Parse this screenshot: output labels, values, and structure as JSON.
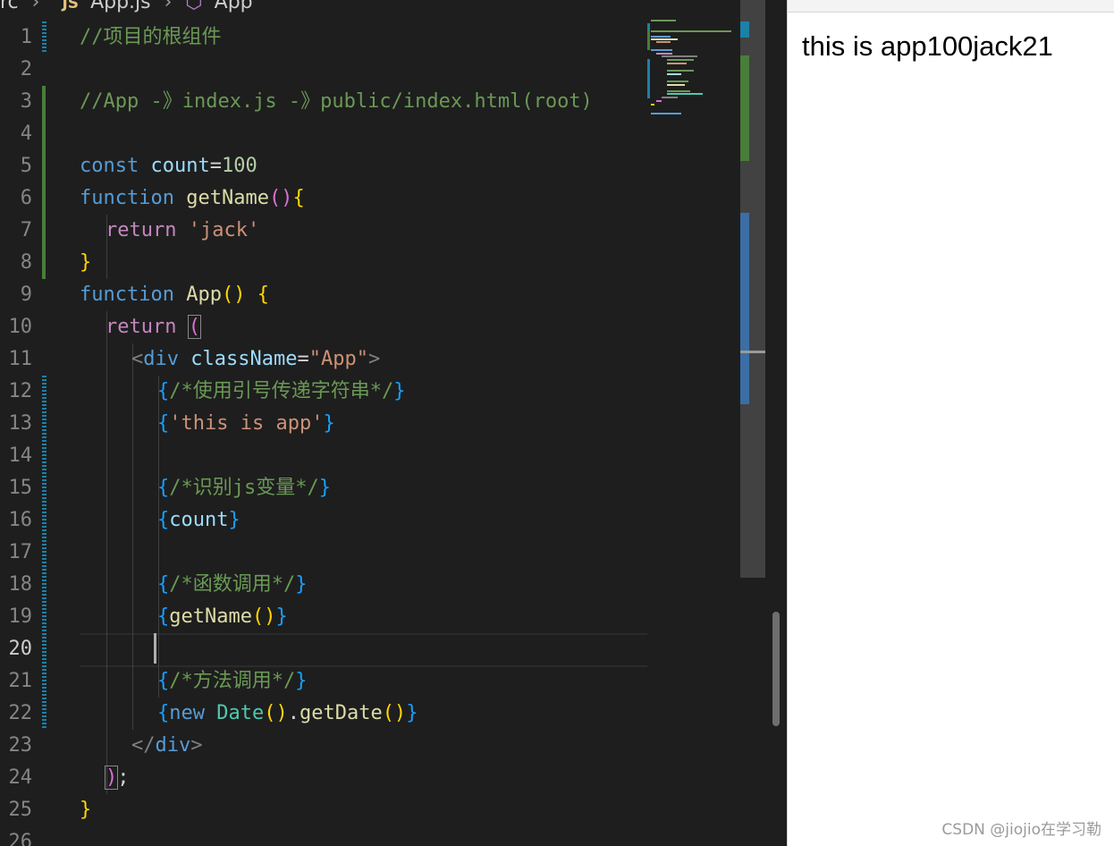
{
  "breadcrumb": {
    "folder": "rc",
    "file_badge": "JS",
    "file": "App.js",
    "symbol": "App",
    "icons": [
      "chevron-right-icon",
      "symbol-class-icon"
    ]
  },
  "editor": {
    "active_line": "20",
    "line_numbers": [
      "1",
      "2",
      "3",
      "4",
      "5",
      "6",
      "7",
      "8",
      "9",
      "10",
      "11",
      "12",
      "13",
      "14",
      "15",
      "16",
      "17",
      "18",
      "19",
      "20",
      "21",
      "22",
      "23",
      "24",
      "25",
      "26"
    ]
  },
  "code": {
    "l1": "//项目的根组件",
    "l3": "//App -》index.js -》public/index.html(root)",
    "l5": {
      "kw": "const",
      "name": "count",
      "op": "=",
      "val": "100"
    },
    "l6": {
      "kw": "function",
      "name": "getName",
      "paren": "()",
      "brace": "{"
    },
    "l7": {
      "kw": "return",
      "str": "'jack'"
    },
    "l8": {
      "brace": "}"
    },
    "l9": {
      "kw": "function",
      "name": "App",
      "paren": "()",
      "brace": "{"
    },
    "l10": {
      "kw": "return",
      "paren": "("
    },
    "l11": {
      "open": "<",
      "tag": "div",
      "attr": "className",
      "eq": "=",
      "val": "\"App\"",
      "close": ">"
    },
    "l12": {
      "lb": "{",
      "comment": "/*使用引号传递字符串*/",
      "rb": "}"
    },
    "l13": {
      "lb": "{",
      "str": "'this is app'",
      "rb": "}"
    },
    "l15": {
      "lb": "{",
      "comment": "/*识别js变量*/",
      "rb": "}"
    },
    "l16": {
      "lb": "{",
      "name": "count",
      "rb": "}"
    },
    "l18": {
      "lb": "{",
      "comment": "/*函数调用*/",
      "rb": "}"
    },
    "l19": {
      "lb": "{",
      "name": "getName",
      "paren": "()",
      "rb": "}"
    },
    "l21": {
      "lb": "{",
      "comment": "/*方法调用*/",
      "rb": "}"
    },
    "l22": {
      "lb": "{",
      "kw": "new ",
      "type": "Date",
      "p1": "()",
      "dot": ".",
      "fn": "getDate",
      "p2": "()",
      "rb": "}"
    },
    "l23": {
      "open": "</",
      "tag": "div",
      "close": ">"
    },
    "l24": {
      "paren": ")",
      "semi": ";"
    },
    "l25": {
      "brace": "}"
    }
  },
  "preview": {
    "output": "this is app100jack21"
  },
  "watermark": "CSDN @jiojio在学习勒",
  "colors": {
    "editor_bg": "#1e1e1e",
    "comment": "#6a9955",
    "keyword": "#569cd6",
    "string": "#ce9178",
    "function": "#dcdcaa",
    "git_added": "#487e3a",
    "git_modified": "#1b81a8"
  }
}
